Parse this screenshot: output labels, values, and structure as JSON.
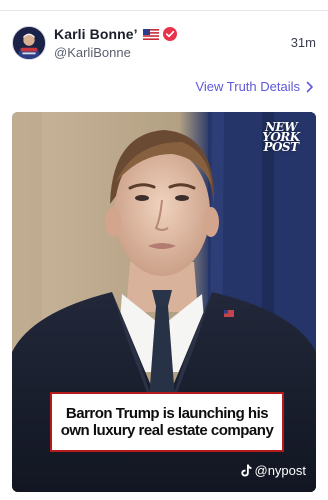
{
  "post": {
    "author": {
      "display_name": "Karli Bonne’",
      "handle": "@KarliBonne",
      "flag_icon": "us-flag-icon",
      "verified_icon": "verified-badge-icon",
      "verified_color": "#e8334a"
    },
    "timestamp": "31m",
    "details_link": {
      "label": "View Truth Details",
      "color": "#5e5ad8"
    },
    "media": {
      "logo_lines": [
        "NEW",
        "YORK",
        "POST"
      ],
      "headline": "Barron Trump is launching his own luxury real estate company",
      "headline_border_color": "#b51b1b",
      "watermark": "@nypost"
    }
  }
}
